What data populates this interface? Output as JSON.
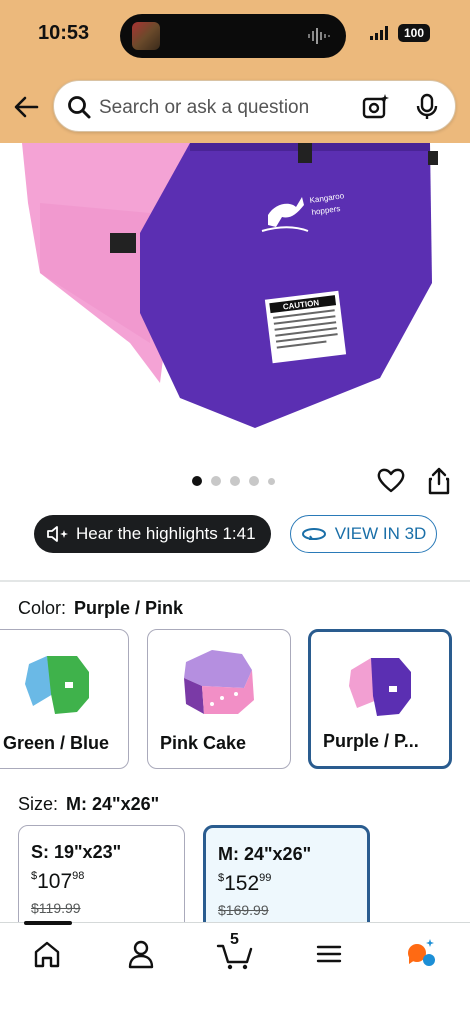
{
  "status_bar": {
    "time": "10:53",
    "battery": "100"
  },
  "search": {
    "placeholder": "Search or ask a question"
  },
  "product_image": {
    "brand_text_line1": "Kangaroo",
    "brand_text_line2": "hoppers",
    "caution_label": "CAUTION"
  },
  "carousel": {
    "count": 5,
    "active_index": 0
  },
  "highlights_button": {
    "label": "Hear the highlights 1:41"
  },
  "view3d_button": {
    "label": "VIEW IN 3D"
  },
  "color": {
    "label": "Color:",
    "selected": "Purple / Pink",
    "options": [
      {
        "label": "Green / Blue"
      },
      {
        "label": "Pink Cake"
      },
      {
        "label": "Purple / P..."
      }
    ]
  },
  "size": {
    "label": "Size:",
    "selected": "M: 24\"x26\"",
    "options": [
      {
        "label": "S: 19\"x23\"",
        "price_symbol": "$",
        "price_whole": "107",
        "price_cents": "98",
        "list_price": "$119.99"
      },
      {
        "label": "M: 24\"x26\"",
        "price_symbol": "$",
        "price_whole": "152",
        "price_cents": "99",
        "list_price": "$169.99"
      }
    ]
  },
  "bottom_nav": {
    "cart_count": "5"
  },
  "colors": {
    "header_bg": "#ecb97c",
    "link_blue": "#1a6fa8",
    "selected_border": "#2a5c8f",
    "mat_pink": "#f29fd2",
    "mat_purple": "#5b2fb2"
  }
}
